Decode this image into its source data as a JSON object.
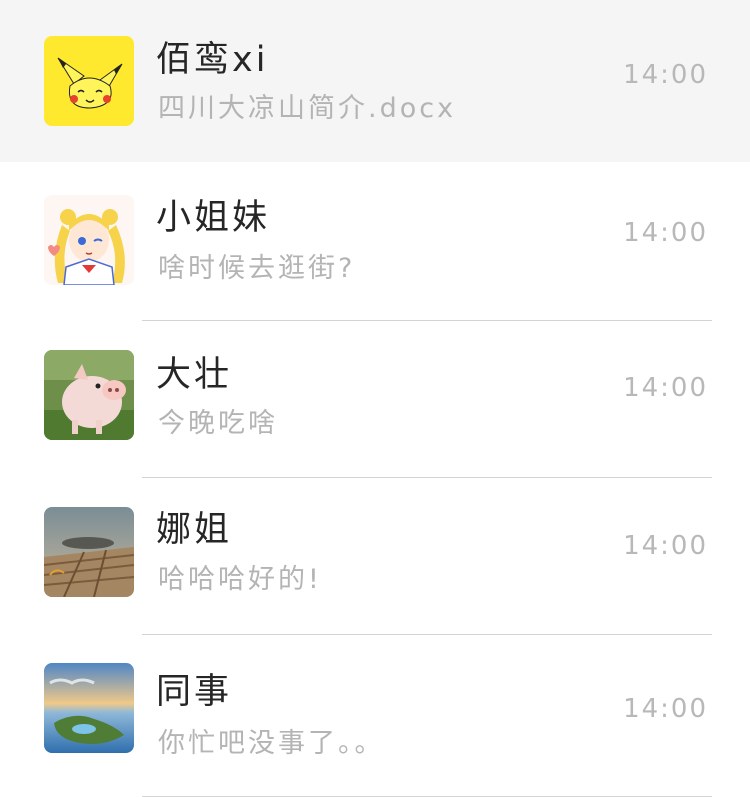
{
  "conversations": [
    {
      "name": "佰鸾xi",
      "preview": "四川大凉山简介.docx",
      "time": "14:00",
      "avatar_icon": "pikachu-avatar-icon",
      "pinned": true
    },
    {
      "name": "小姐妹",
      "preview": "啥时候去逛街?",
      "time": "14:00",
      "avatar_icon": "sailor-moon-avatar-icon"
    },
    {
      "name": "大壮",
      "preview": "今晚吃啥",
      "time": "14:00",
      "avatar_icon": "piglet-avatar-icon"
    },
    {
      "name": "娜姐",
      "preview": "哈哈哈好的!",
      "time": "14:00",
      "avatar_icon": "wooden-dock-avatar-icon"
    },
    {
      "name": "同事",
      "preview": "你忙吧没事了。。",
      "time": "14:00",
      "avatar_icon": "seaside-landscape-avatar-icon"
    }
  ],
  "colors": {
    "pinned_background": "#f5f5f5",
    "name_text": "#262626",
    "preview_text": "#b4b4b4",
    "time_text": "#b8b8b8",
    "divider": "#d4d4d4"
  }
}
